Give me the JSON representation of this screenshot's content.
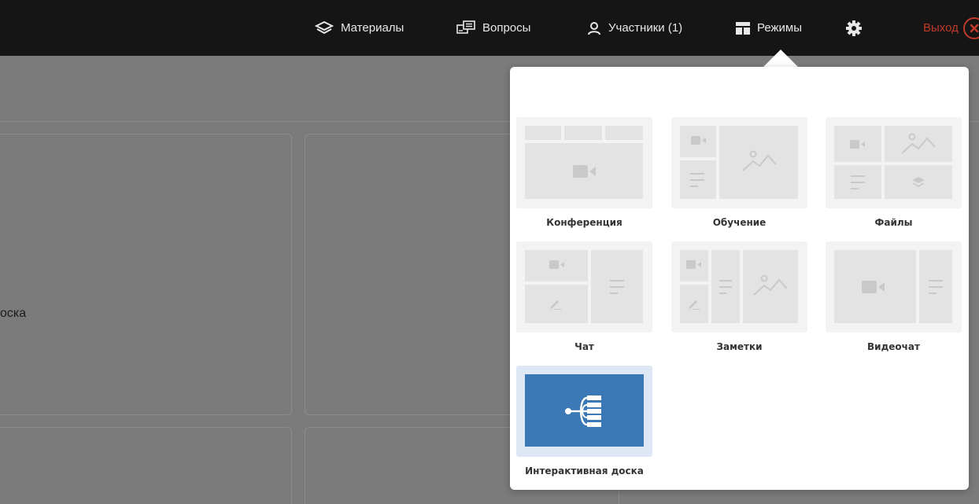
{
  "topbar": {
    "materials": "Материалы",
    "questions": "Вопросы",
    "participants": "Участники (1)",
    "modes": "Режимы",
    "exit": "Выход"
  },
  "background": {
    "card_text": "оска"
  },
  "modes_popover": {
    "items": [
      {
        "label": "Конференция"
      },
      {
        "label": "Обучение"
      },
      {
        "label": "Файлы"
      },
      {
        "label": "Чат"
      },
      {
        "label": "Заметки"
      },
      {
        "label": "Видеочат"
      },
      {
        "label": "Интерактивная доска",
        "active": true
      }
    ]
  },
  "colors": {
    "topbar_bg": "#151515",
    "overlay": "#7b7b7b",
    "exit_red": "#c0392b",
    "active_blue": "#3a79b5"
  }
}
